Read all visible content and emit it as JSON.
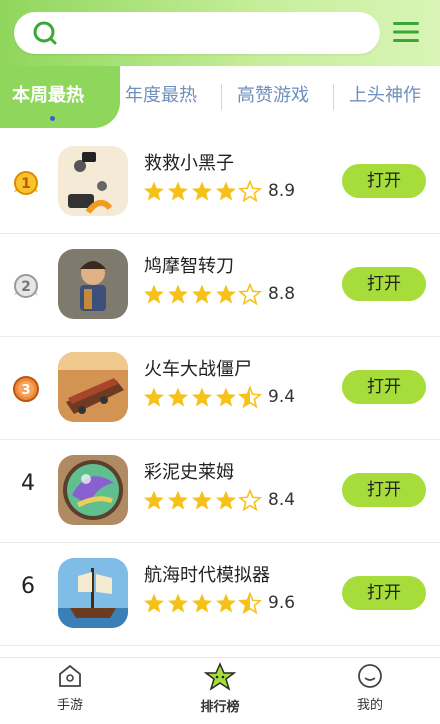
{
  "tabs": [
    {
      "label": "本周最热",
      "active": true
    },
    {
      "label": "年度最热",
      "active": false
    },
    {
      "label": "高赞游戏",
      "active": false
    },
    {
      "label": "上头神作",
      "active": false
    }
  ],
  "open_label": "打开",
  "games": [
    {
      "rank": "1",
      "rank_style": "gold",
      "name": "救救小黑子",
      "stars": 4,
      "score": "8.9",
      "icon": "game-icon-jiujiu"
    },
    {
      "rank": "2",
      "rank_style": "silver",
      "name": "鸠摩智转刀",
      "stars": 4,
      "score": "8.8",
      "icon": "game-icon-jiumozhi"
    },
    {
      "rank": "3",
      "rank_style": "bronze",
      "name": "火车大战僵尸",
      "stars": 4.5,
      "score": "9.4",
      "icon": "game-icon-train"
    },
    {
      "rank": "4",
      "rank_style": "plain",
      "name": "彩泥史莱姆",
      "stars": 4,
      "score": "8.4",
      "icon": "game-icon-slime"
    },
    {
      "rank": "6",
      "rank_style": "plain",
      "name": "航海时代模拟器",
      "stars": 4.5,
      "score": "9.6",
      "icon": "game-icon-ship"
    }
  ],
  "nav": [
    {
      "label": "手游",
      "active": false,
      "icon": "home-icon"
    },
    {
      "label": "排行榜",
      "active": true,
      "icon": "star-icon"
    },
    {
      "label": "我的",
      "active": false,
      "icon": "profile-icon"
    }
  ],
  "colors": {
    "accent_green": "#8fd65c",
    "button_green": "#a7dd3b",
    "star_yellow": "#f6c21a",
    "tab_blue": "#6f8fbd"
  }
}
